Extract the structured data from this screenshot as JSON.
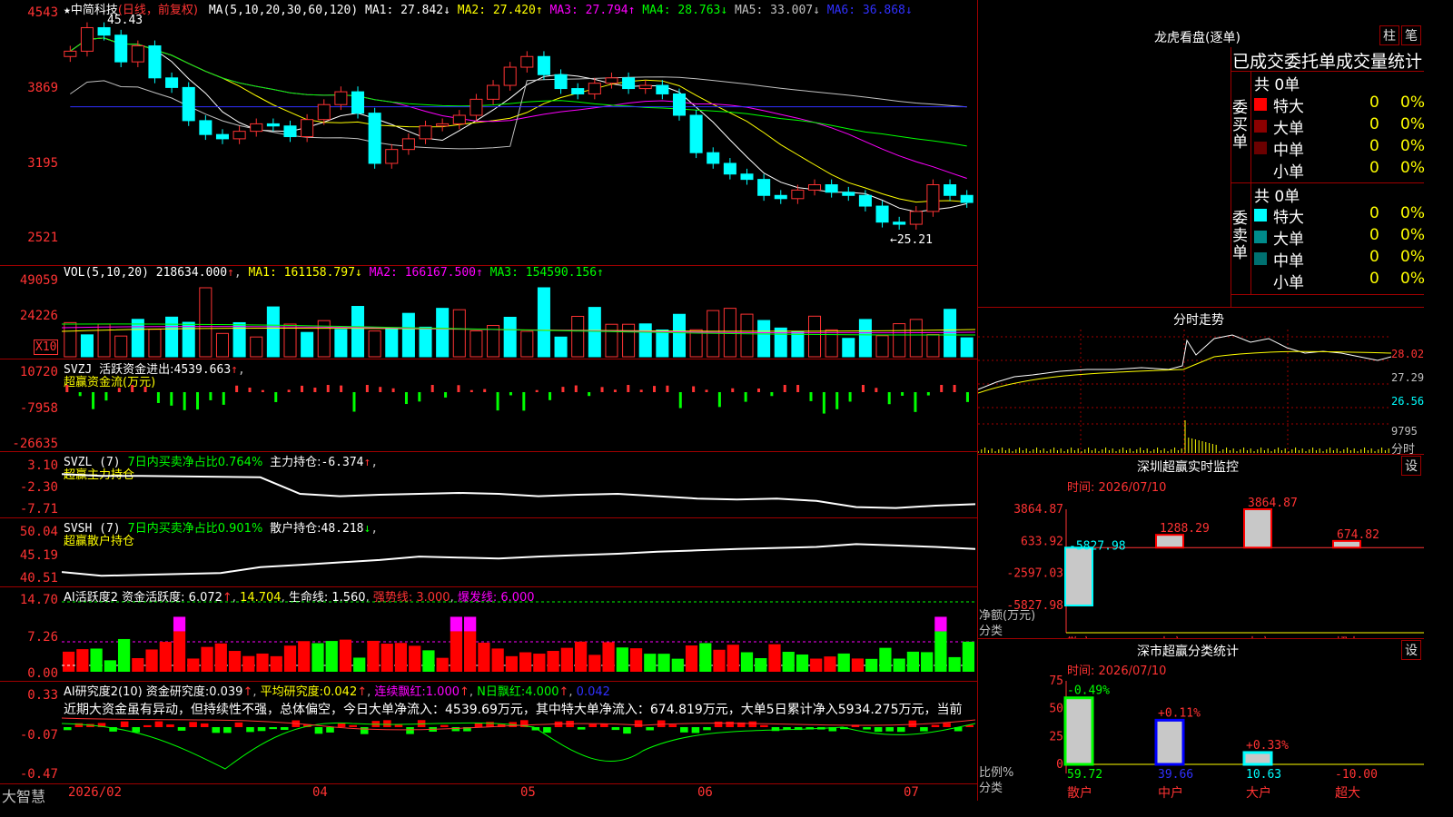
{
  "stock": {
    "name": "中简科技",
    "mode": "(日线，前复权)",
    "star": "★"
  },
  "main": {
    "ma_header": "MA(5,10,20,30,60,120)",
    "ma_values": [
      {
        "label": "MA1:",
        "value": "27.842",
        "arrow": "↓",
        "color": "#ffffff"
      },
      {
        "label": "MA2:",
        "value": "27.420",
        "arrow": "↑",
        "color": "#ffff00"
      },
      {
        "label": "MA3:",
        "value": "27.794",
        "arrow": "↑",
        "color": "#ff00ff"
      },
      {
        "label": "MA4:",
        "value": "28.763",
        "arrow": "↓",
        "color": "#00ff00"
      },
      {
        "label": "MA5:",
        "value": "33.007",
        "arrow": "↓",
        "color": "#c0c0c0"
      },
      {
        "label": "MA6:",
        "value": "36.868",
        "arrow": "↓",
        "color": "#3030ff"
      }
    ],
    "y_ticks": [
      "4543",
      "3869",
      "3195",
      "2521"
    ],
    "high_label": "45.43",
    "low_label": "←25.21"
  },
  "vol": {
    "header": "VOL(5,10,20)",
    "value": "218634.000",
    "items": [
      {
        "label": "MA1:",
        "value": "161158.797",
        "arrow": "↓",
        "color": "#ffff00"
      },
      {
        "label": "MA2:",
        "value": "166167.500",
        "arrow": "↑",
        "color": "#ff00ff"
      },
      {
        "label": "MA3:",
        "value": "154590.156",
        "arrow": "↑",
        "color": "#00ff00"
      }
    ],
    "y_ticks": [
      "49059",
      "24226"
    ],
    "unit": "X10"
  },
  "svzj": {
    "header": "SVZJ",
    "label": "活跃资金进出:",
    "value": "4539.663",
    "arrow": "↑",
    "sub": "超赢资金流(万元)",
    "y_ticks": [
      "10720",
      "-7958",
      "-26635"
    ]
  },
  "svzl": {
    "header": "SVZL (7)",
    "ratio": "7日内买卖净占比0.764%",
    "label": "主力持仓:",
    "value": "-6.374",
    "arrow": "↑",
    "sub": "超赢主力持仓",
    "y_ticks": [
      "3.10",
      "-2.30",
      "-7.71"
    ]
  },
  "svsh": {
    "header": "SVSH (7)",
    "ratio": "7日内买卖净占比0.901%",
    "label": "散户持仓:",
    "value": "48.218",
    "arrow": "↓",
    "sub": "超赢散户持仓",
    "y_ticks": [
      "50.04",
      "45.19",
      "40.51"
    ]
  },
  "ai_active": {
    "header": "AI活跃度2",
    "label1": "资金活跃度:",
    "v1": "6.072",
    "v2": "14.704",
    "label3": "生命线:",
    "v3": "1.560",
    "strong": "强势线: 3.000",
    "burst": "爆发线: 6.000",
    "y_ticks": [
      "14.70",
      "7.26",
      "0.00"
    ]
  },
  "ai_research": {
    "header": "AI研究度2(10)",
    "label1": "资金研究度:",
    "v1": "0.039",
    "label2": "平均研究度:",
    "v2": "0.042",
    "label3": "连续飘红:",
    "v3": "1.000",
    "label4": "N日飘红:",
    "v4": "4.000",
    "v5": "0.042",
    "comment": "近期大资金虽有异动，但持续性不强，总体偏空，今日大单净流入：4539.69万元，其中特大单净流入：674.819万元，大单5日累计净入5934.275万元，当前",
    "y_ticks": [
      "0.33",
      "-0.07",
      "-0.47"
    ]
  },
  "time_axis": {
    "brand": "大智慧",
    "labels": [
      "2026/02",
      "04",
      "05",
      "06",
      "07"
    ]
  },
  "dragon": {
    "title": "龙虎看盘(逐单)",
    "btn1": "柱",
    "btn2": "笔",
    "subtitle": "已成交委托单成交量统计",
    "buy": {
      "side": "委买单",
      "total": "共 0单",
      "rows": [
        {
          "name": "特大",
          "count": "0",
          "pct": "0%",
          "color": "#ff0000"
        },
        {
          "name": "大单",
          "count": "0",
          "pct": "0%",
          "color": "#8b0000"
        },
        {
          "name": "中单",
          "count": "0",
          "pct": "0%",
          "color": "#6b0000"
        },
        {
          "name": "小单",
          "count": "0",
          "pct": "0%",
          "color": "#000000"
        }
      ]
    },
    "sell": {
      "side": "委卖单",
      "total": "共 0单",
      "rows": [
        {
          "name": "特大",
          "count": "0",
          "pct": "0%",
          "color": "#00ffff"
        },
        {
          "name": "大单",
          "count": "0",
          "pct": "0%",
          "color": "#008b8b"
        },
        {
          "name": "中单",
          "count": "0",
          "pct": "0%",
          "color": "#007070"
        },
        {
          "name": "小单",
          "count": "0",
          "pct": "0%",
          "color": "#000000"
        }
      ]
    }
  },
  "intraday": {
    "title": "分时走势",
    "y_ticks": [
      "28.02",
      "27.29",
      "26.56"
    ],
    "vol_tick": "9795",
    "unit": "分时"
  },
  "monitor": {
    "title": "深圳超赢实时监控",
    "btn": "设",
    "time": "时间: 2026/07/10",
    "y_ticks": [
      "3864.87",
      "633.92",
      "-2597.03",
      "-5827.98"
    ],
    "y_label": "净额(万元)",
    "x_label": "分类",
    "categories": [
      "散户",
      "中户",
      "大户",
      "超大"
    ],
    "values": [
      -5827.98,
      1288.29,
      3864.87,
      674.82
    ],
    "value_labels": [
      "-5827.98",
      "1288.29",
      "3864.87",
      "674.82"
    ]
  },
  "classify": {
    "title": "深市超赢分类统计",
    "btn": "设",
    "time": "时间: 2026/07/10",
    "y_ticks": [
      "75",
      "50",
      "25",
      "0"
    ],
    "y_label": "比例%",
    "x_label": "分类",
    "categories": [
      "散户",
      "中户",
      "大户",
      "超大"
    ],
    "values": [
      59.72,
      39.66,
      10.63,
      -10.0
    ],
    "value_labels": [
      "59.72",
      "39.66",
      "10.63",
      "-10.00"
    ],
    "changes": [
      "-0.49%",
      "+0.11%",
      "+0.33%",
      ""
    ]
  },
  "chart_data": [
    {
      "type": "candlestick",
      "title": "中简科技 (日线，前复权)",
      "ylim": [
        25.21,
        45.43
      ],
      "x": [
        "2026/02",
        "04",
        "05",
        "06",
        "07"
      ],
      "close": [
        42.0,
        44.2,
        43.5,
        41.0,
        42.5,
        39.5,
        38.6,
        35.5,
        34.2,
        33.8,
        34.5,
        35.2,
        35.0,
        34.0,
        35.6,
        37.0,
        38.2,
        36.2,
        31.5,
        32.8,
        33.8,
        35.0,
        35.2,
        36.0,
        37.5,
        38.8,
        40.5,
        41.5,
        39.8,
        38.5,
        38.0,
        39.0,
        39.5,
        38.5,
        38.8,
        38.0,
        36.0,
        32.5,
        31.5,
        30.5,
        30.0,
        28.5,
        28.2,
        29.0,
        29.5,
        28.8,
        28.5,
        27.5,
        26.0,
        25.8,
        27.0,
        29.5,
        28.5,
        27.84
      ]
    },
    {
      "type": "bar",
      "title": "VOL(5,10,20)",
      "ylim": [
        0,
        49059
      ]
    },
    {
      "type": "bar",
      "title": "超赢资金流(万元)",
      "ylim": [
        -26635,
        10720
      ]
    },
    {
      "type": "line",
      "title": "超赢主力持仓",
      "ylim": [
        -7.71,
        3.1
      ]
    },
    {
      "type": "line",
      "title": "超赢散户持仓",
      "ylim": [
        40.51,
        50.04
      ]
    },
    {
      "type": "bar",
      "title": "AI活跃度2",
      "ylim": [
        0,
        14.7
      ]
    },
    {
      "type": "bar",
      "title": "AI研究度2(10)",
      "ylim": [
        -0.47,
        0.33
      ]
    },
    {
      "type": "bar",
      "title": "深圳超赢实时监控",
      "categories": [
        "散户",
        "中户",
        "大户",
        "超大"
      ],
      "values": [
        -5827.98,
        1288.29,
        3864.87,
        674.82
      ],
      "ylim": [
        -5827.98,
        3864.87
      ]
    },
    {
      "type": "bar",
      "title": "深市超赢分类统计",
      "categories": [
        "散户",
        "中户",
        "大户",
        "超大"
      ],
      "values": [
        59.72,
        39.66,
        10.63,
        -10.0
      ],
      "ylim": [
        0,
        75
      ]
    }
  ]
}
